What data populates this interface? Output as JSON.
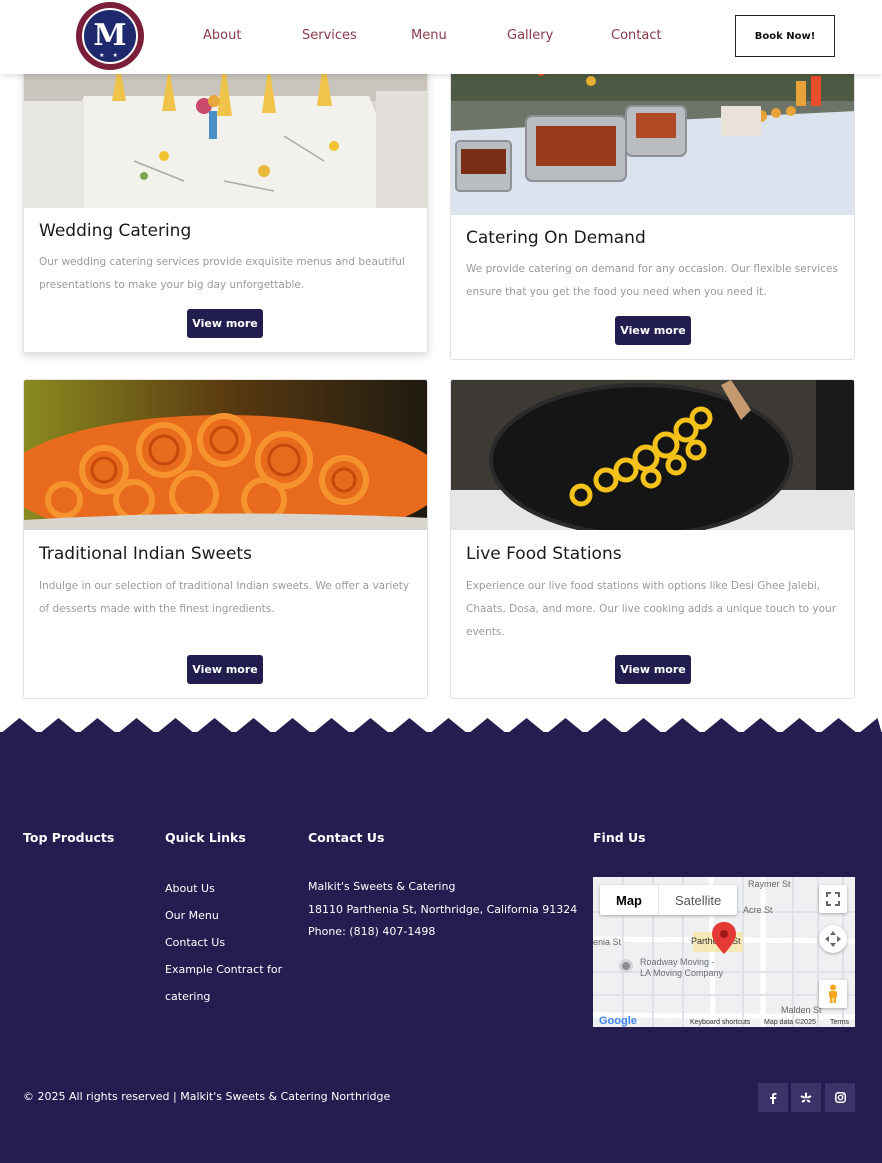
{
  "header": {
    "logo_letter": "M",
    "logo_stars": "★ ★",
    "nav": [
      "About",
      "Services",
      "Menu",
      "Gallery",
      "Contact"
    ],
    "cta": "Book Now!"
  },
  "cards": [
    {
      "title": "Wedding Catering",
      "text": "Our wedding catering services provide exquisite menus and beautiful presentations to make your big day unforgettable.",
      "button": "View more"
    },
    {
      "title": "Catering On Demand",
      "text": "We provide catering on demand for any occasion. Our flexible services ensure that you get the food you need when you need it.",
      "button": "View more"
    },
    {
      "title": "Traditional Indian Sweets",
      "text": "Indulge in our selection of traditional Indian sweets. We offer a variety of desserts made with the finest ingredients.",
      "button": "View more"
    },
    {
      "title": "Live Food Stations",
      "text": "Experience our live food stations with options like Desi Ghee Jalebi, Chaats, Dosa, and more. Our live cooking adds a unique touch to your events.",
      "button": "View more"
    }
  ],
  "footer": {
    "col_top_products": "Top Products",
    "col_quick_links": "Quick Links",
    "col_contact": "Contact Us",
    "col_find": "Find Us",
    "quick_links": [
      "About Us",
      "Our Menu",
      "Contact Us",
      "Example Contract for",
      "catering"
    ],
    "contact": {
      "name": "Malkit's Sweets & Catering",
      "address": "18110 Parthenia St, Northridge, California 91324",
      "phone": "Phone: (818) 407-1498"
    },
    "copyright": "© 2025 All rights reserved | Malkit's Sweets & Catering Northridge",
    "social_icons": [
      "facebook-icon",
      "yelp-icon",
      "instagram-icon"
    ]
  },
  "map": {
    "tabs": [
      "Map",
      "Satellite"
    ],
    "streets": [
      "Parthenia St",
      "Roadway Moving -",
      "LA Moving Company",
      "enia St",
      "Acre St",
      "Malden St",
      "Raymer St"
    ],
    "google": "Google",
    "keyboard": "Keyboard shortcuts",
    "data": "Map data ©2025",
    "terms": "Terms"
  },
  "colors": {
    "brand_navy": "#241d4f",
    "button_navy": "#221d4f",
    "nav_text": "#8a3a4a",
    "map_pin": "#e53935"
  }
}
